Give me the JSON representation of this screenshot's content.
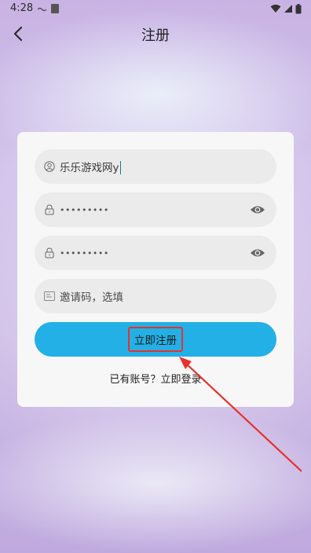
{
  "status_bar": {
    "time": "4:28"
  },
  "header": {
    "title": "注册"
  },
  "form": {
    "username": {
      "value": "乐乐游戏网y"
    },
    "password": {
      "value": "•••••••••"
    },
    "confirm_password": {
      "value": "•••••••••"
    },
    "invite_code": {
      "placeholder": "邀请码，选填"
    },
    "submit_label": "立即注册",
    "login_prompt": "已有账号？立即登录"
  },
  "colors": {
    "accent": "#22b0e6",
    "annotation": "#e8312c"
  },
  "icons": [
    "back-arrow-icon",
    "user-icon",
    "lock-icon",
    "eye-icon",
    "invite-code-icon",
    "wifi-icon",
    "battery-icon"
  ]
}
